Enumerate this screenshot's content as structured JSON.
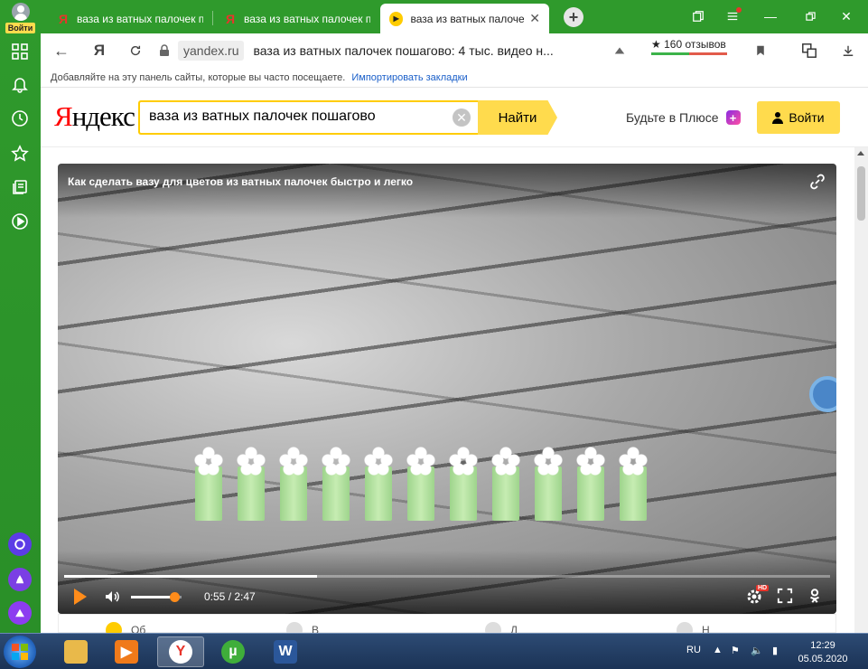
{
  "sidebar": {
    "login_label": "Войти"
  },
  "tabs": [
    {
      "title": "ваза из ватных палочек п",
      "favicon": "Я"
    },
    {
      "title": "ваза из ватных палочек п",
      "favicon": "Я"
    },
    {
      "title": "ваза из ватных палочек",
      "favicon": "▶",
      "active": true
    }
  ],
  "address": {
    "domain": "yandex.ru",
    "page_title": "ваза из ватных палочек пошагово: 4 тыс. видео н...",
    "rating_label": "★ 160 отзывов"
  },
  "bookmarks": {
    "hint": "Добавляйте на эту панель сайты, которые вы часто посещаете.",
    "import_link": "Импортировать закладки"
  },
  "header": {
    "logo_first": "Я",
    "logo_rest": "ндекс",
    "search_value": "ваза из ватных палочек пошагово",
    "find_button": "Найти",
    "plus_link": "Будьте в Плюсе",
    "login_button": "Войти"
  },
  "video": {
    "title": "Как сделать вазу для цветов из ватных палочек быстро и легко",
    "time": "0:55 / 2:47",
    "progress": 0.33,
    "volume": 0.85,
    "hd_badge": "HD"
  },
  "below_player": [
    "Об",
    "В",
    "Д",
    "Н"
  ],
  "taskbar": {
    "lang": "RU",
    "time": "12:29",
    "date": "05.05.2020"
  },
  "colors": {
    "sidebar_green": "#2f9a2c",
    "yandex_yellow": "#ffdb4d",
    "player_accent": "#ff8c1a"
  }
}
